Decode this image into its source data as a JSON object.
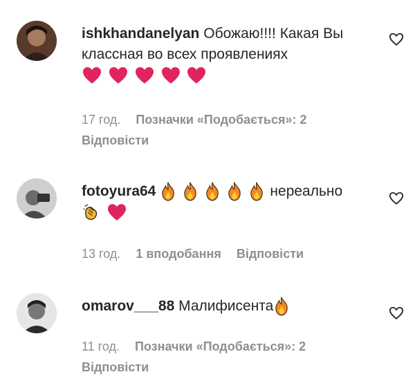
{
  "comments": [
    {
      "username": "ishkhandanelyan",
      "text": "Обожаю!!!! Какая Вы классная во всех проявлениях",
      "emojis": [
        "red-heart",
        "red-heart",
        "red-heart",
        "red-heart",
        "red-heart"
      ],
      "time": "17 год.",
      "likes": "Позначки «Подобається»: 2",
      "reply": "Відповісти"
    },
    {
      "username": "fotoyura64",
      "emojis_lead": [
        "fire",
        "fire",
        "fire",
        "fire",
        "fire"
      ],
      "text": "нереально",
      "emojis_tail": [
        "clapping-hands",
        "red-heart"
      ],
      "time": "13 год.",
      "likes": "1 вподобання",
      "reply": "Відповісти"
    },
    {
      "username": "omarov___88",
      "text": "Малифисента",
      "emojis": [
        "fire"
      ],
      "time": "11 год.",
      "likes": "Позначки «Подобається»: 2",
      "reply": "Відповісти"
    }
  ],
  "colors": {
    "text": "#262626",
    "muted": "#8e8e8e",
    "heart": "#e0245e",
    "fire": "#f58a1f"
  },
  "icons": {
    "like": "heart-outline-icon"
  }
}
